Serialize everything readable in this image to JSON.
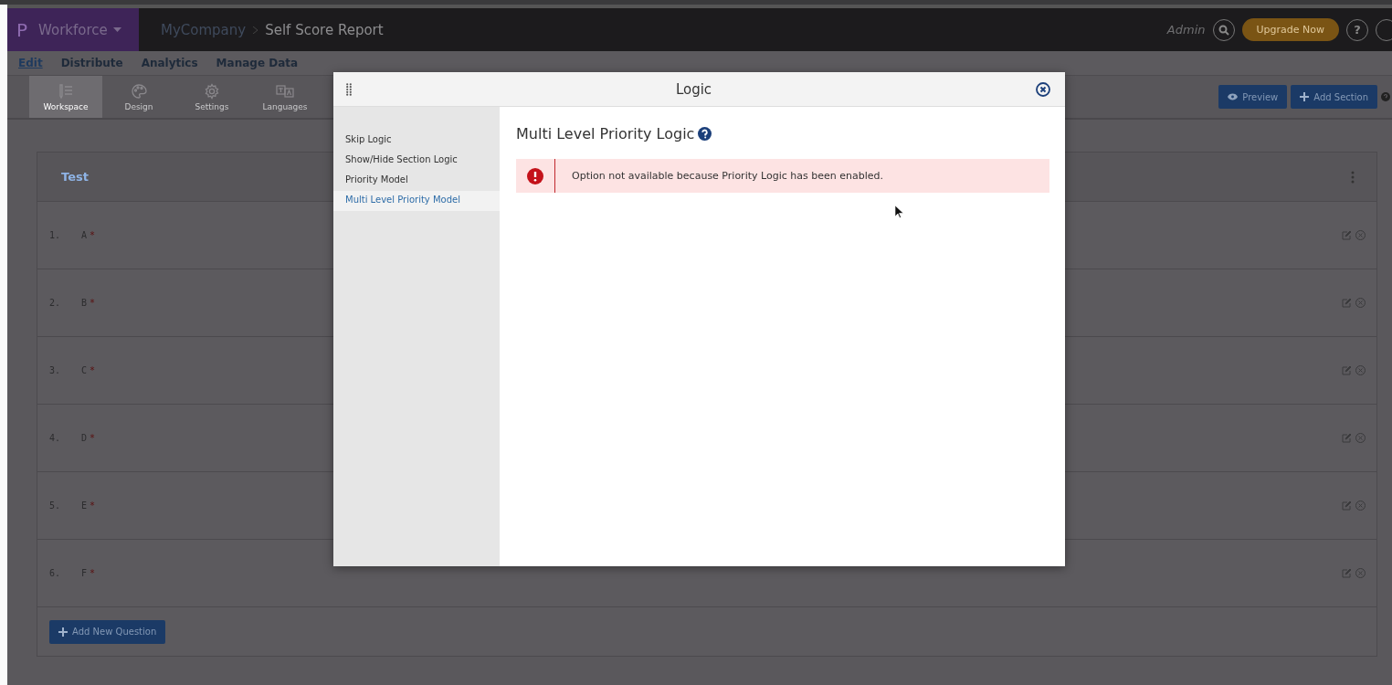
{
  "header": {
    "brand": "P",
    "workspace": "Workforce",
    "breadcrumb": [
      "MyCompany",
      "Self Score Report"
    ],
    "user": "Admin",
    "upgrade_button": "Upgrade Now",
    "help": "?"
  },
  "menu": [
    {
      "label": "Edit",
      "selected": true
    },
    {
      "label": "Distribute",
      "selected": false
    },
    {
      "label": "Analytics",
      "selected": false
    },
    {
      "label": "Manage Data",
      "selected": false
    }
  ],
  "toolbar": [
    {
      "label": "Workspace",
      "kind": "list",
      "selected": true
    },
    {
      "label": "Design",
      "kind": "palette",
      "selected": false
    },
    {
      "label": "Settings",
      "kind": "gear",
      "selected": false
    },
    {
      "label": "Languages",
      "kind": "translate",
      "selected": false
    }
  ],
  "actions": [
    {
      "label": "Preview",
      "kind": "eye"
    },
    {
      "label": "Add Section",
      "kind": "plus"
    }
  ],
  "section": {
    "title": "Test",
    "questions": [
      {
        "number": "1.",
        "label": "A",
        "mark": "*"
      },
      {
        "number": "2.",
        "label": "B",
        "mark": "*"
      },
      {
        "number": "3.",
        "label": "C",
        "mark": "*"
      },
      {
        "number": "4.",
        "label": "D",
        "mark": "*"
      },
      {
        "number": "5.",
        "label": "E",
        "mark": "*"
      },
      {
        "number": "6.",
        "label": "F",
        "mark": "*"
      }
    ],
    "add_button": "Add New Question"
  },
  "modal": {
    "title": "Logic",
    "nav": [
      {
        "label": "Skip Logic",
        "selected": false
      },
      {
        "label": "Show/Hide Section Logic",
        "selected": false
      },
      {
        "label": "Priority Model",
        "selected": false
      },
      {
        "label": "Multi Level Priority Model",
        "selected": true
      }
    ],
    "heading": "Multi Level Priority Logic",
    "alert": "Option not available because Priority Logic has been enabled."
  }
}
